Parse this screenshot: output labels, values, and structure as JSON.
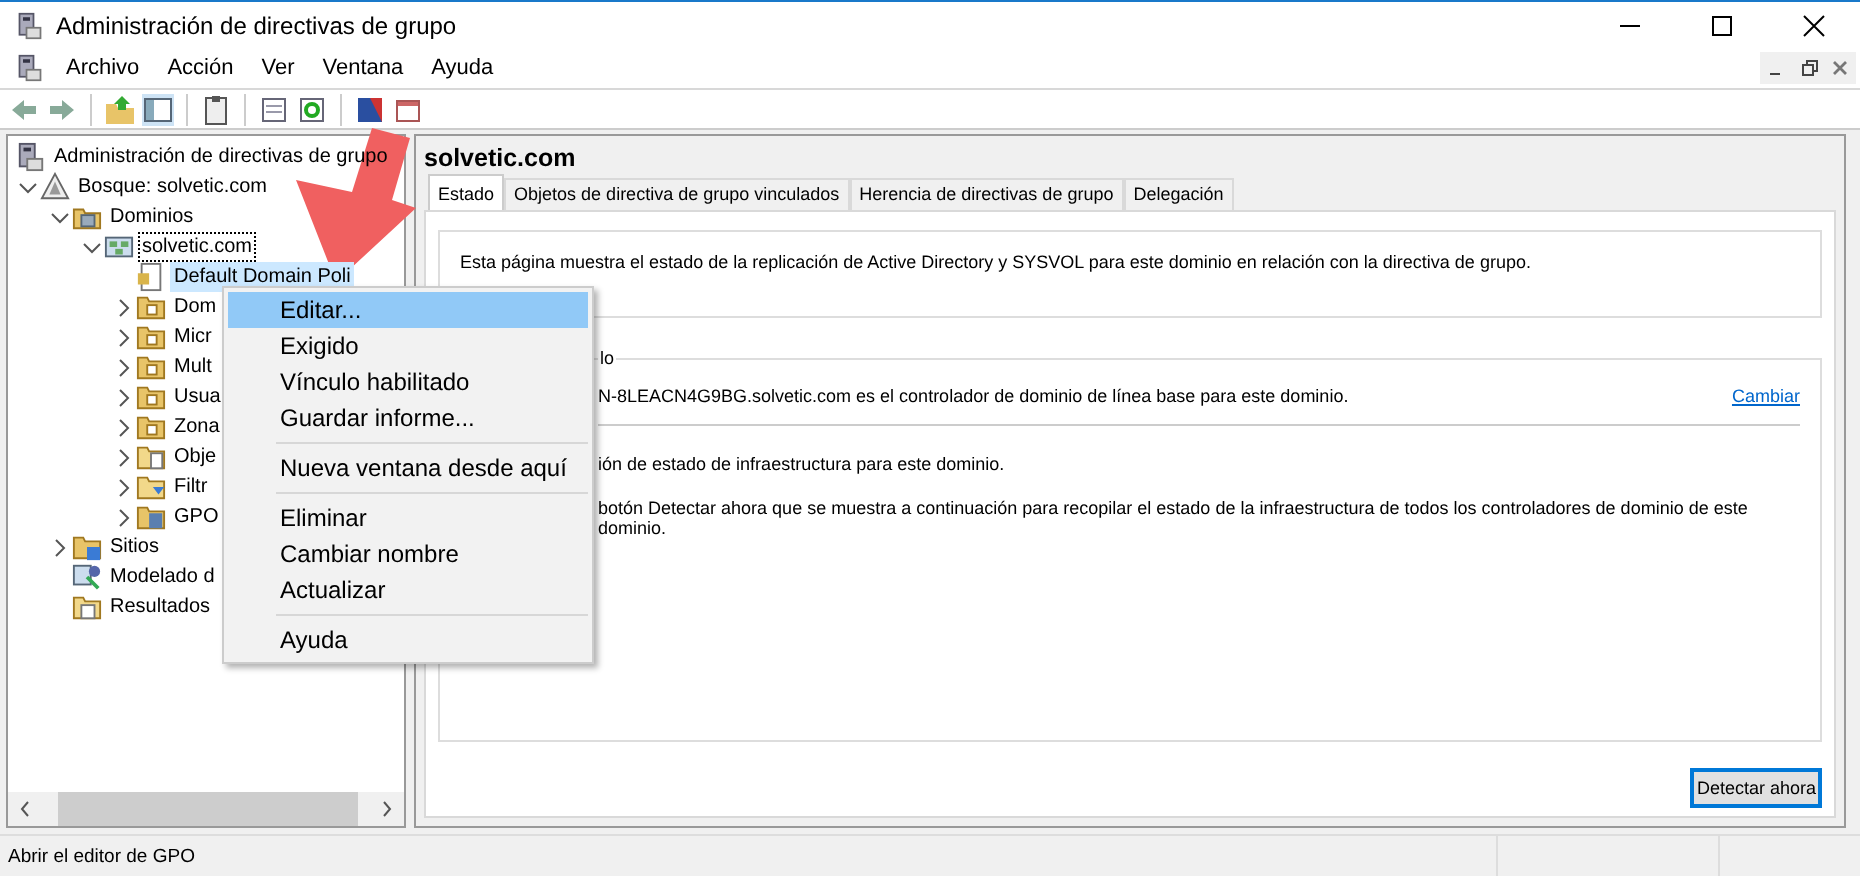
{
  "window": {
    "title": "Administración de directivas de grupo"
  },
  "menu_bar": [
    "Archivo",
    "Acción",
    "Ver",
    "Ventana",
    "Ayuda"
  ],
  "tree": [
    {
      "label": "Administración de directivas de grupo",
      "kind": "console",
      "selected": false,
      "children": [
        {
          "label": "Bosque: solvetic.com",
          "kind": "forest",
          "expanded": true,
          "selected": false,
          "children": [
            {
              "label": "Dominios",
              "kind": "domains",
              "expanded": true,
              "selected": false,
              "children": [
                {
                  "label": "solvetic.com",
                  "kind": "domain",
                  "expanded": true,
                  "selected": false,
                  "focused": true,
                  "children": [
                    {
                      "label": "Default Domain Poli",
                      "kind": "gpo",
                      "selected": true
                    },
                    {
                      "label": "Dom",
                      "kind": "ou",
                      "expanded": false,
                      "selected": false
                    },
                    {
                      "label": "Micr",
                      "kind": "ou",
                      "expanded": false,
                      "selected": false
                    },
                    {
                      "label": "Mult",
                      "kind": "ou",
                      "expanded": false,
                      "selected": false
                    },
                    {
                      "label": "Usua",
                      "kind": "ou",
                      "expanded": false,
                      "selected": false
                    },
                    {
                      "label": "Zona",
                      "kind": "ou",
                      "expanded": false,
                      "selected": false
                    },
                    {
                      "label": "Obje",
                      "kind": "gpofolder",
                      "expanded": false,
                      "selected": false
                    },
                    {
                      "label": "Filtr",
                      "kind": "wmi",
                      "expanded": false,
                      "selected": false
                    },
                    {
                      "label": "GPO",
                      "kind": "starter",
                      "expanded": false,
                      "selected": false
                    }
                  ]
                }
              ]
            },
            {
              "label": "Sitios",
              "kind": "sites",
              "expanded": false,
              "selected": false
            },
            {
              "label": "Modelado d",
              "kind": "modeling",
              "selected": false
            },
            {
              "label": "Resultados",
              "kind": "results",
              "selected": false
            }
          ]
        }
      ]
    }
  ],
  "details": {
    "title": "solvetic.com",
    "tabs": [
      {
        "label": "Estado",
        "selected": true
      },
      {
        "label": "Objetos de directiva de grupo vinculados",
        "selected": false
      },
      {
        "label": "Herencia de directivas de grupo",
        "selected": false
      },
      {
        "label": "Delegación",
        "selected": false
      }
    ],
    "intro": "Esta página muestra el estado de la replicación de Active Directory y SYSVOL para este dominio en relación con la directiva de grupo.",
    "group_label": "lo",
    "baseline": "N-8LEACN4G9BG.solvetic.com es el controlador de dominio de línea base para este dominio.",
    "change_link": "Cambiar",
    "line_1": "ión de estado de infraestructura para este dominio.",
    "line_2": "botón Detectar ahora que se muestra a continuación para recopilar el estado de la infraestructura de todos los controladores de dominio de este dominio.",
    "detect_button": "Detectar ahora"
  },
  "context_menu": {
    "groups": [
      [
        {
          "label": "Editar...",
          "selected": true
        },
        {
          "label": "Exigido",
          "selected": false
        },
        {
          "label": "Vínculo habilitado",
          "selected": false
        },
        {
          "label": "Guardar informe...",
          "selected": false
        }
      ],
      [
        {
          "label": "Nueva ventana desde aquí",
          "selected": false
        }
      ],
      [
        {
          "label": "Eliminar",
          "selected": false
        },
        {
          "label": "Cambiar nombre",
          "selected": false
        },
        {
          "label": "Actualizar",
          "selected": false
        }
      ],
      [
        {
          "label": "Ayuda",
          "selected": false
        }
      ]
    ]
  },
  "status_bar": "Abrir el editor de GPO"
}
